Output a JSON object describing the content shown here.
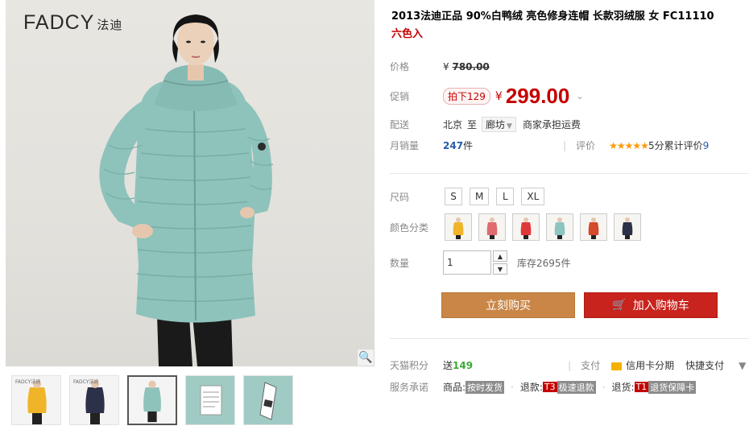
{
  "gallery": {
    "brand": "FADCY",
    "brand_cn": "法迪",
    "thumb_brand": "FADCY法迪",
    "zoom_icon": "magnifier-icon"
  },
  "product": {
    "title": "2013法迪正品 90%白鸭绒 亮色修身连帽 长款羽绒服 女 FC11110",
    "subtitle": "六色入"
  },
  "price": {
    "label": "价格",
    "currency": "¥",
    "original": "780.00"
  },
  "promo": {
    "label": "促销",
    "tag": "拍下129",
    "currency": "¥",
    "price": "299.00",
    "chevron": "⌄"
  },
  "shipping": {
    "label": "配送",
    "from": "北京",
    "to_word": "至",
    "dest": "廊坊",
    "note": "商家承担运费"
  },
  "sales": {
    "label": "月销量",
    "count": "247",
    "unit": "件",
    "rating_label": "评价",
    "stars": "★★★★★",
    "score_text": "5分累计评价",
    "review_count": "9"
  },
  "size": {
    "label": "尺码",
    "options": [
      "S",
      "M",
      "L",
      "XL"
    ]
  },
  "color": {
    "label": "颜色分类",
    "swatches": [
      "#f0b429",
      "#e06a70",
      "#e03838",
      "#8cc4c0",
      "#d44a2a",
      "#2c3048"
    ]
  },
  "quantity": {
    "label": "数量",
    "value": "1",
    "stock": "库存2695件"
  },
  "actions": {
    "buy": "立刻购买",
    "cart": "加入购物车"
  },
  "points": {
    "label": "天猫积分",
    "prefix": "送",
    "value": "149",
    "pay_label": "支付",
    "card_pay": "信用卡分期",
    "quick_pay": "快捷支付"
  },
  "service": {
    "label": "服务承诺",
    "goods_label": "商品:",
    "goods_tag": "按时发货",
    "refund_label": "退款:",
    "refund_code": "T3",
    "refund_tag": "极速退款",
    "return_label": "退货:",
    "return_code": "T1",
    "return_tag": "退货保障卡"
  },
  "colors": {
    "price_red": "#c40000",
    "buy_button": "#c98646",
    "cart_button": "#c8231d",
    "coat_teal": "#8ec3bb",
    "link_blue": "#2a5aa8",
    "points_green": "#39a935"
  }
}
